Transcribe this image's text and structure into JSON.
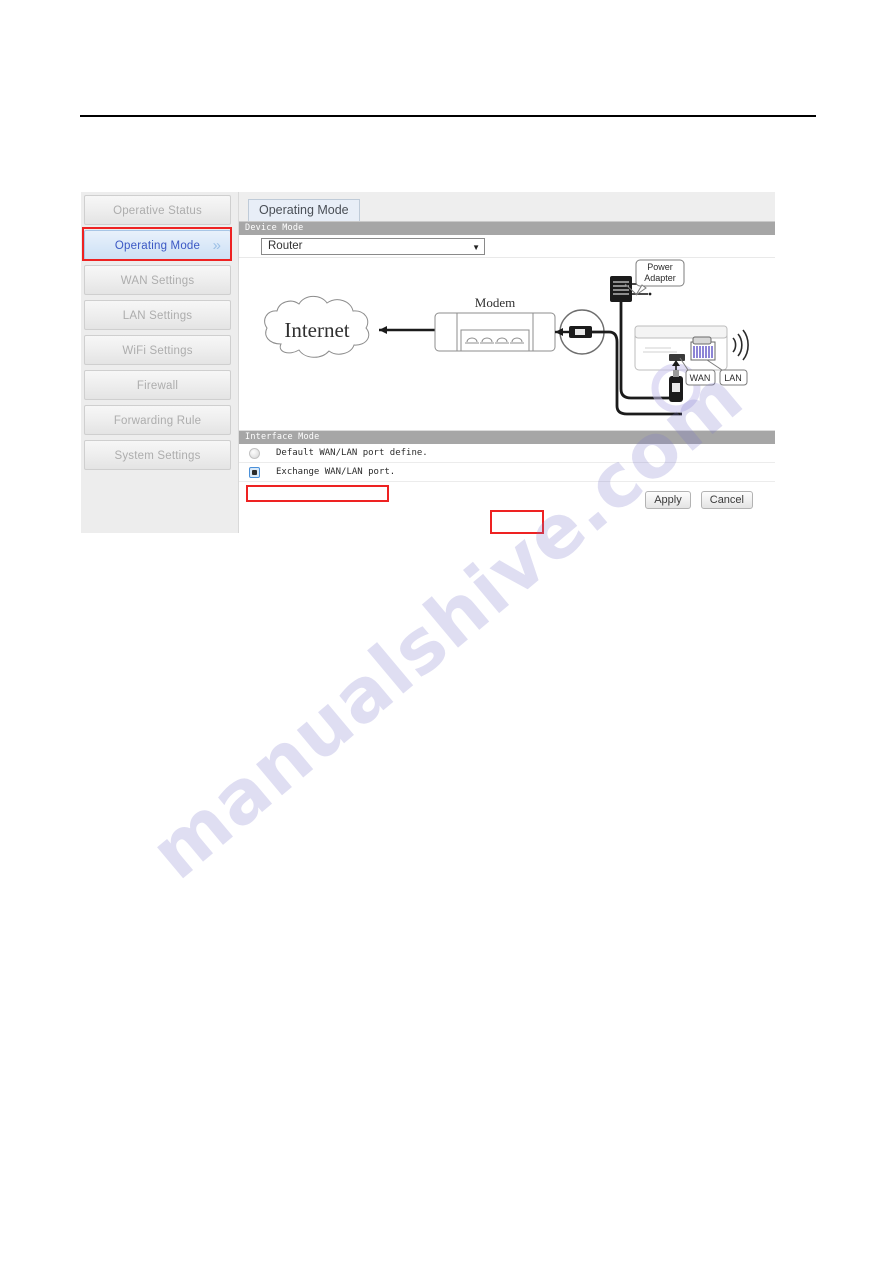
{
  "document": {
    "watermark": "manualshive.com"
  },
  "router_ui": {
    "sidebar": {
      "items": [
        {
          "label": "Operative Status",
          "active": false
        },
        {
          "label": "Operating Mode",
          "active": true,
          "chevron": "»"
        },
        {
          "label": "WAN Settings",
          "active": false
        },
        {
          "label": "LAN Settings",
          "active": false
        },
        {
          "label": "WiFi Settings",
          "active": false
        },
        {
          "label": "Firewall",
          "active": false
        },
        {
          "label": "Forwarding Rule",
          "active": false
        },
        {
          "label": "System Settings",
          "active": false
        }
      ]
    },
    "tab": {
      "label": "Operating Mode"
    },
    "device_mode": {
      "section_title": "Device Mode",
      "selected": "Router",
      "options": [
        "Router"
      ],
      "arrow_icon": "▼"
    },
    "diagram": {
      "internet_label": "Internet",
      "modem_label": "Modem",
      "power_adapter_label_line1": "Power",
      "power_adapter_label_line2": "Adapter",
      "wan_label": "WAN",
      "lan_label": "LAN"
    },
    "interface_mode": {
      "section_title": "Interface Mode",
      "options": [
        {
          "label": "Default WAN/LAN port define.",
          "selected": false
        },
        {
          "label": "Exchange WAN/LAN port.",
          "selected": true
        }
      ]
    },
    "actions": {
      "apply_label": "Apply",
      "cancel_label": "Cancel"
    },
    "colors": {
      "highlight": "#ee2222",
      "active_nav_text": "#3b58c4",
      "section_header_bg": "#a6a6a6"
    }
  }
}
